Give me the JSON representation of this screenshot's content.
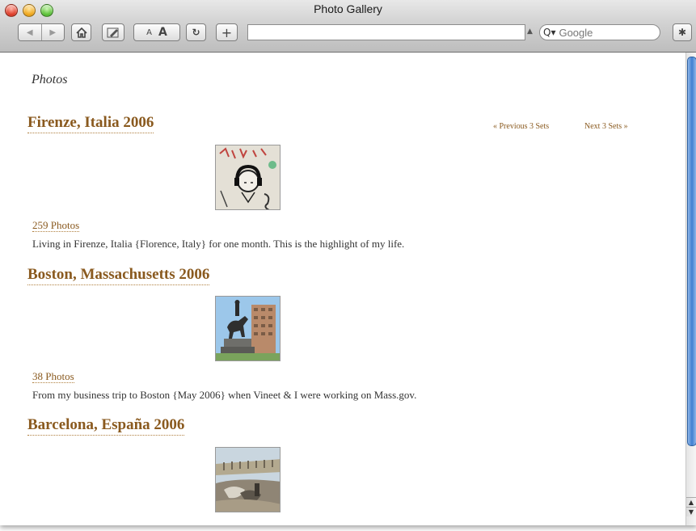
{
  "window": {
    "title": "Photo Gallery"
  },
  "toolbar": {
    "back_icon": "back-arrow-icon",
    "forward_icon": "forward-arrow-icon",
    "home_icon": "home-icon",
    "edit_icon": "edit-pencil-icon",
    "text_smaller_label": "A",
    "text_bigger_label": "A",
    "reload_icon": "reload-icon",
    "add_label": "+",
    "address_value": "",
    "search_placeholder": "Google",
    "bug_icon": "bug-icon"
  },
  "page": {
    "heading": "Photos",
    "pager": {
      "previous": "« Previous 3 Sets",
      "next": "Next 3 Sets »"
    },
    "sets": [
      {
        "title": "Firenze, Italia 2006",
        "count": "259 Photos",
        "description": "Living in Firenze, Italia {Florence, Italy} for one month. This is the highlight of my life."
      },
      {
        "title": "Boston, Massachusetts 2006",
        "count": "38 Photos",
        "description": "From my business trip to Boston {May 2006} when Vineet & I were working on Mass.gov."
      },
      {
        "title": "Barcelona, España 2006",
        "count": ""
      }
    ]
  },
  "colors": {
    "link": "#8a5a1f",
    "text": "#333333"
  }
}
